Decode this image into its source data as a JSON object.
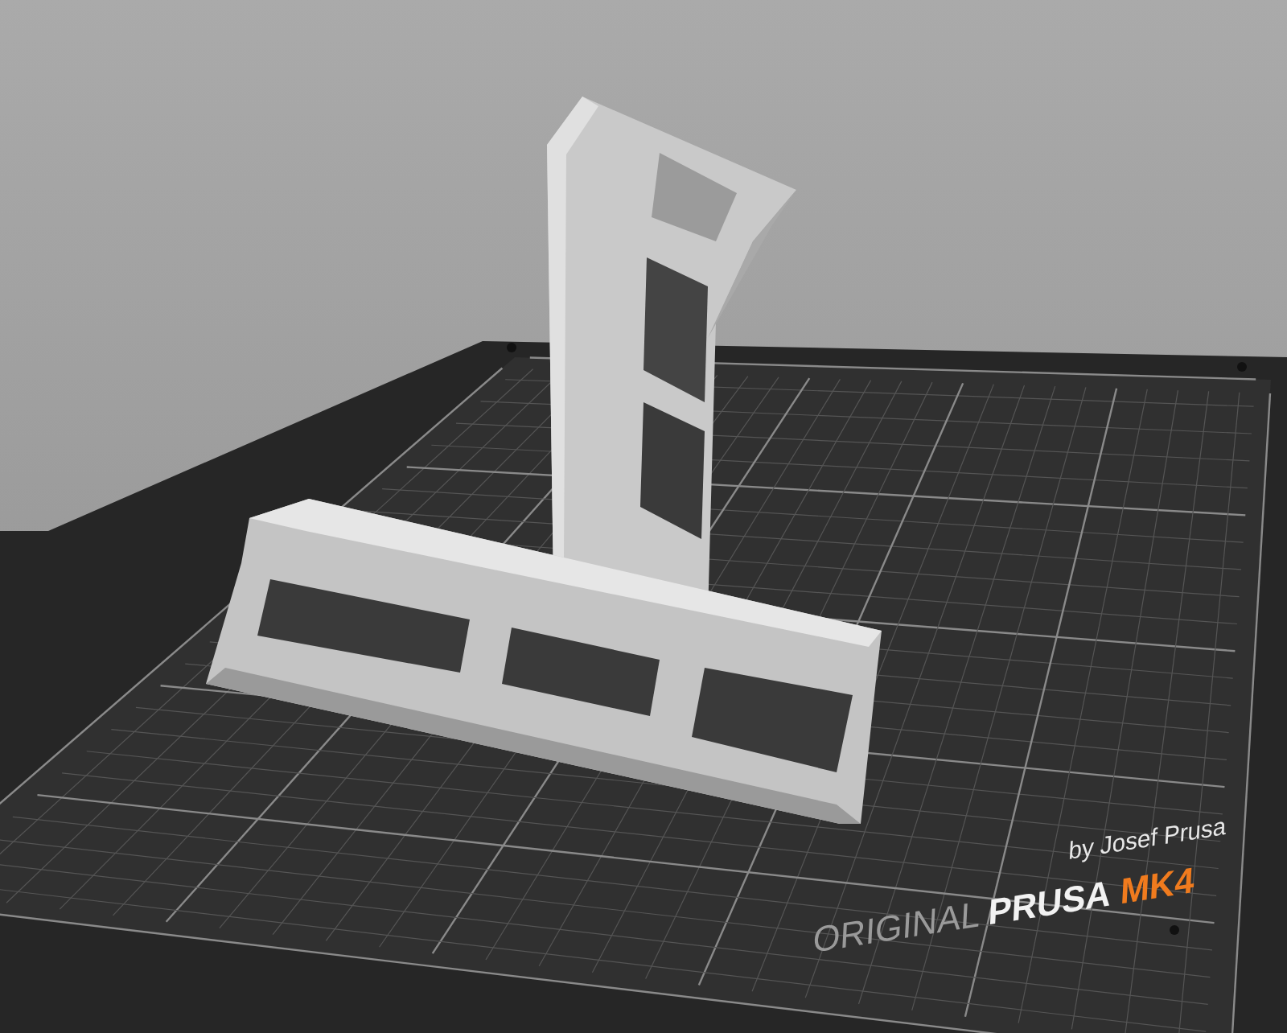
{
  "bed_logo": {
    "text": "ORIGINAL **PRUSA** *MK4*",
    "byline": "by Josef Prusa"
  }
}
